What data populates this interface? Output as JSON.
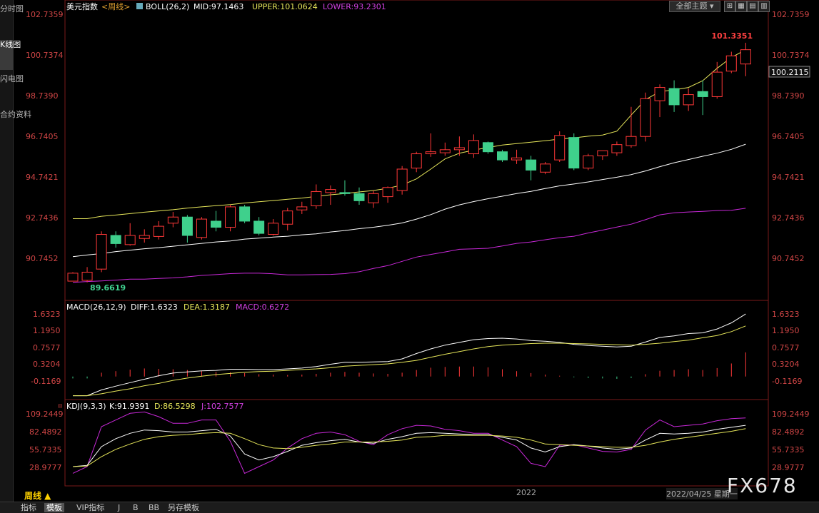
{
  "left_tabs": [
    "分时图",
    "K线图",
    "闪电图",
    "合约资料"
  ],
  "toolbar": {
    "theme_label": "全部主题",
    "icons": [
      "split-view-icon",
      "grid-icon",
      "layout-icon",
      "layout-alt-icon"
    ]
  },
  "main_panel": {
    "title": "美元指数",
    "period_tag": "<周线>",
    "indicator_name": "BOLL(26,2)",
    "mid_label": "MID:97.1463",
    "upper_label": "UPPER:101.0624",
    "lower_label": "LOWER:93.2301",
    "y_ticks": [
      "102.7359",
      "100.7374",
      "98.7390",
      "96.7405",
      "94.7421",
      "92.7436",
      "90.7452"
    ],
    "current_price": "100.2115",
    "high_label": "101.3351",
    "low_label": "89.6619"
  },
  "macd_panel": {
    "indicator_name": "MACD(26,12,9)",
    "diff_label": "DIFF:1.6323",
    "dea_label": "DEA:1.3187",
    "macd_label": "MACD:0.6272",
    "y_ticks": [
      "1.6323",
      "1.1950",
      "0.7577",
      "0.3204",
      "-0.1169"
    ]
  },
  "kdj_panel": {
    "indicator_name": "KDJ(9,3,3)",
    "k_label": "K:91.9391",
    "d_label": "D:86.5298",
    "j_label": "J:102.7577",
    "y_ticks": [
      "109.2449",
      "82.4892",
      "55.7335",
      "28.9777"
    ]
  },
  "bottom": {
    "period_button": "周线 ▲",
    "year_label": "2022",
    "date_label": "2022/04/25 星期一",
    "tabs": [
      "指标",
      "模板",
      "VIP指标",
      "J",
      "B",
      "BB",
      "另存模板"
    ],
    "active_tab": "模板"
  },
  "watermark": "FX678",
  "colors": {
    "up": "#ff3838",
    "down": "#3fd08c",
    "mid": "#ffffff",
    "upper": "#e6e65a",
    "lower": "#c828d8",
    "axis_text": "#d24646"
  },
  "chart_data": {
    "type": "candlestick",
    "title": "美元指数 <周线>",
    "candles": [
      {
        "o": 89.66,
        "h": 90.1,
        "l": 89.66,
        "c": 90.05
      },
      {
        "o": 89.7,
        "h": 90.35,
        "l": 89.6,
        "c": 90.1
      },
      {
        "o": 90.25,
        "h": 92.1,
        "l": 90.1,
        "c": 91.95
      },
      {
        "o": 91.9,
        "h": 92.1,
        "l": 91.3,
        "c": 91.5
      },
      {
        "o": 91.45,
        "h": 92.5,
        "l": 91.4,
        "c": 91.9
      },
      {
        "o": 91.75,
        "h": 92.2,
        "l": 91.55,
        "c": 91.9
      },
      {
        "o": 91.85,
        "h": 92.6,
        "l": 91.7,
        "c": 92.35
      },
      {
        "o": 92.5,
        "h": 93.05,
        "l": 92.3,
        "c": 92.8
      },
      {
        "o": 92.8,
        "h": 92.9,
        "l": 91.55,
        "c": 91.9
      },
      {
        "o": 91.8,
        "h": 92.8,
        "l": 91.7,
        "c": 92.7
      },
      {
        "o": 92.6,
        "h": 93.1,
        "l": 92.1,
        "c": 92.3
      },
      {
        "o": 92.3,
        "h": 93.4,
        "l": 92.1,
        "c": 93.3
      },
      {
        "o": 93.3,
        "h": 93.4,
        "l": 92.5,
        "c": 92.6
      },
      {
        "o": 92.6,
        "h": 92.8,
        "l": 91.9,
        "c": 92.0
      },
      {
        "o": 91.95,
        "h": 92.7,
        "l": 91.9,
        "c": 92.5
      },
      {
        "o": 92.45,
        "h": 93.25,
        "l": 92.15,
        "c": 93.1
      },
      {
        "o": 93.15,
        "h": 93.55,
        "l": 92.95,
        "c": 93.3
      },
      {
        "o": 93.35,
        "h": 94.4,
        "l": 93.2,
        "c": 94.05
      },
      {
        "o": 94.0,
        "h": 94.35,
        "l": 93.4,
        "c": 94.15
      },
      {
        "o": 94.0,
        "h": 94.6,
        "l": 93.85,
        "c": 93.95
      },
      {
        "o": 93.95,
        "h": 94.25,
        "l": 93.4,
        "c": 93.6
      },
      {
        "o": 93.5,
        "h": 94.1,
        "l": 93.25,
        "c": 93.95
      },
      {
        "o": 93.8,
        "h": 94.3,
        "l": 93.5,
        "c": 94.25
      },
      {
        "o": 94.1,
        "h": 95.3,
        "l": 93.9,
        "c": 95.15
      },
      {
        "o": 95.2,
        "h": 96.0,
        "l": 95.0,
        "c": 95.9
      },
      {
        "o": 95.9,
        "h": 96.9,
        "l": 95.75,
        "c": 96.0
      },
      {
        "o": 95.95,
        "h": 96.45,
        "l": 95.8,
        "c": 96.1
      },
      {
        "o": 96.1,
        "h": 96.75,
        "l": 95.8,
        "c": 96.2
      },
      {
        "o": 95.9,
        "h": 96.85,
        "l": 95.7,
        "c": 96.55
      },
      {
        "o": 96.45,
        "h": 96.5,
        "l": 95.9,
        "c": 96.0
      },
      {
        "o": 96.0,
        "h": 96.1,
        "l": 95.5,
        "c": 95.6
      },
      {
        "o": 95.6,
        "h": 96.1,
        "l": 95.4,
        "c": 95.7
      },
      {
        "o": 95.6,
        "h": 95.8,
        "l": 94.6,
        "c": 95.1
      },
      {
        "o": 95.0,
        "h": 95.5,
        "l": 94.9,
        "c": 95.4
      },
      {
        "o": 95.6,
        "h": 97.0,
        "l": 95.5,
        "c": 96.8
      },
      {
        "o": 96.7,
        "h": 96.9,
        "l": 95.1,
        "c": 95.2
      },
      {
        "o": 95.2,
        "h": 95.9,
        "l": 95.1,
        "c": 95.8
      },
      {
        "o": 95.8,
        "h": 96.0,
        "l": 95.6,
        "c": 96.05
      },
      {
        "o": 95.95,
        "h": 96.5,
        "l": 95.8,
        "c": 96.35
      },
      {
        "o": 96.3,
        "h": 98.2,
        "l": 96.2,
        "c": 96.75
      },
      {
        "o": 96.75,
        "h": 98.9,
        "l": 96.5,
        "c": 98.6
      },
      {
        "o": 98.5,
        "h": 99.3,
        "l": 97.7,
        "c": 99.15
      },
      {
        "o": 99.1,
        "h": 99.5,
        "l": 97.95,
        "c": 98.3
      },
      {
        "o": 98.3,
        "h": 99.1,
        "l": 98.0,
        "c": 98.8
      },
      {
        "o": 98.95,
        "h": 99.5,
        "l": 97.8,
        "c": 98.7
      },
      {
        "o": 98.7,
        "h": 100.4,
        "l": 98.6,
        "c": 99.9
      },
      {
        "o": 99.95,
        "h": 100.9,
        "l": 99.85,
        "c": 100.7
      },
      {
        "o": 100.3,
        "h": 101.34,
        "l": 99.7,
        "c": 101.0
      }
    ],
    "boll_mid": [
      90.86,
      90.94,
      91.01,
      91.11,
      91.18,
      91.25,
      91.3,
      91.37,
      91.44,
      91.51,
      91.58,
      91.63,
      91.72,
      91.77,
      91.82,
      91.86,
      91.93,
      91.98,
      92.07,
      92.14,
      92.23,
      92.3,
      92.4,
      92.51,
      92.7,
      92.92,
      93.19,
      93.4,
      93.56,
      93.7,
      93.82,
      93.95,
      94.06,
      94.2,
      94.33,
      94.42,
      94.52,
      94.64,
      94.75,
      94.88,
      95.06,
      95.27,
      95.46,
      95.62,
      95.78,
      95.93,
      96.12,
      96.37
    ],
    "boll_upper": [
      92.72,
      92.72,
      92.84,
      92.9,
      92.97,
      93.04,
      93.1,
      93.16,
      93.24,
      93.3,
      93.36,
      93.41,
      93.49,
      93.55,
      93.61,
      93.67,
      93.73,
      93.81,
      93.89,
      93.95,
      94.03,
      94.1,
      94.21,
      94.37,
      94.67,
      95.15,
      95.65,
      95.93,
      96.08,
      96.21,
      96.33,
      96.4,
      96.47,
      96.54,
      96.62,
      96.68,
      96.76,
      96.82,
      97.01,
      97.8,
      98.55,
      98.95,
      99.03,
      99.15,
      99.48,
      100.09,
      100.62,
      101.0
    ],
    "boll_lower": [
      89.6,
      89.64,
      89.67,
      89.71,
      89.76,
      89.76,
      89.79,
      89.82,
      89.87,
      89.94,
      89.98,
      90.03,
      90.05,
      90.05,
      90.02,
      89.97,
      89.97,
      89.98,
      89.99,
      90.03,
      90.12,
      90.28,
      90.42,
      90.63,
      90.84,
      90.97,
      91.09,
      91.22,
      91.24,
      91.27,
      91.38,
      91.51,
      91.58,
      91.69,
      91.79,
      91.86,
      92.02,
      92.16,
      92.31,
      92.45,
      92.67,
      92.91,
      93.01,
      93.05,
      93.08,
      93.12,
      93.13,
      93.23
    ],
    "macd_diff": [
      -0.5,
      -0.5,
      -0.35,
      -0.25,
      -0.16,
      -0.07,
      0.02,
      0.09,
      0.12,
      0.15,
      0.16,
      0.19,
      0.19,
      0.18,
      0.18,
      0.2,
      0.22,
      0.26,
      0.32,
      0.37,
      0.37,
      0.38,
      0.39,
      0.46,
      0.6,
      0.72,
      0.82,
      0.89,
      0.96,
      0.99,
      1.0,
      0.98,
      0.94,
      0.92,
      0.89,
      0.84,
      0.81,
      0.79,
      0.77,
      0.79,
      0.9,
      1.02,
      1.06,
      1.12,
      1.14,
      1.24,
      1.4,
      1.63
    ],
    "macd_dea": [
      -0.5,
      -0.5,
      -0.45,
      -0.38,
      -0.32,
      -0.24,
      -0.18,
      -0.1,
      -0.04,
      0.01,
      0.05,
      0.08,
      0.11,
      0.13,
      0.14,
      0.16,
      0.18,
      0.2,
      0.23,
      0.27,
      0.29,
      0.31,
      0.33,
      0.37,
      0.42,
      0.5,
      0.58,
      0.65,
      0.72,
      0.78,
      0.82,
      0.84,
      0.86,
      0.87,
      0.87,
      0.86,
      0.85,
      0.84,
      0.83,
      0.82,
      0.84,
      0.87,
      0.91,
      0.95,
      1.01,
      1.07,
      1.17,
      1.32
    ],
    "macd_hist": [
      -0.05,
      -0.05,
      0.1,
      0.14,
      0.18,
      0.21,
      0.2,
      0.19,
      0.17,
      0.15,
      0.12,
      0.11,
      0.09,
      0.06,
      0.05,
      0.04,
      0.05,
      0.07,
      0.1,
      0.12,
      0.1,
      0.08,
      0.07,
      0.1,
      0.17,
      0.23,
      0.25,
      0.26,
      0.26,
      0.24,
      0.19,
      0.14,
      0.09,
      0.05,
      0.02,
      -0.02,
      -0.04,
      -0.05,
      -0.06,
      -0.04,
      0.06,
      0.15,
      0.17,
      0.19,
      0.17,
      0.22,
      0.34,
      0.63
    ],
    "kdj_k": [
      30,
      32,
      60,
      72,
      80,
      85,
      84,
      82,
      82,
      84,
      86,
      76,
      49,
      40,
      45,
      53,
      62,
      66,
      69,
      71,
      67,
      65,
      71,
      75,
      80,
      81,
      80,
      79,
      78,
      78,
      74,
      70,
      58,
      52,
      60,
      63,
      61,
      58,
      56,
      58,
      70,
      80,
      79,
      80,
      82,
      86,
      89,
      92
    ],
    "kdj_d": [
      30,
      31,
      45,
      56,
      64,
      71,
      75,
      77,
      78,
      80,
      81,
      80,
      72,
      63,
      58,
      57,
      59,
      62,
      64,
      67,
      67,
      67,
      68,
      70,
      74,
      75,
      77,
      77,
      77,
      77,
      76,
      74,
      70,
      64,
      63,
      62,
      61,
      60,
      59,
      59,
      62,
      67,
      71,
      74,
      77,
      80,
      83,
      87
    ],
    "kdj_j": [
      20,
      30,
      90,
      100,
      110,
      112,
      105,
      95,
      95,
      100,
      100,
      68,
      20,
      30,
      40,
      58,
      72,
      80,
      82,
      78,
      68,
      63,
      78,
      87,
      92,
      91,
      86,
      84,
      80,
      80,
      70,
      60,
      35,
      30,
      62,
      63,
      58,
      53,
      52,
      56,
      85,
      100,
      90,
      92,
      94,
      99,
      102,
      103
    ]
  }
}
